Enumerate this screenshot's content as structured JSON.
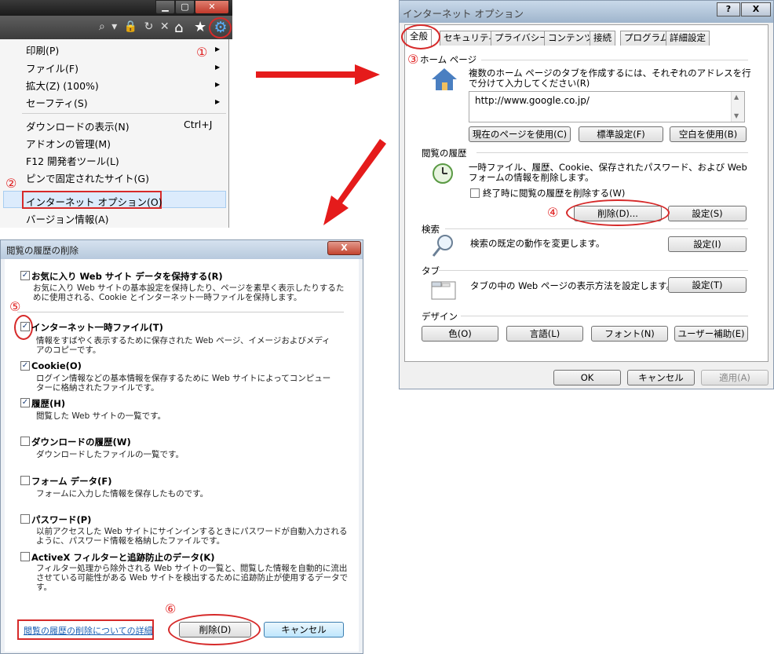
{
  "panel_menu": {
    "window_buttons": {
      "minimize": "▁",
      "maximize": "▢",
      "close": "✕"
    },
    "toolbar_icons": [
      "search-icon",
      "lock-icon",
      "refresh-icon",
      "stop-icon",
      "home-icon",
      "favorites-icon",
      "gear-icon"
    ],
    "toolbar_glyphs": {
      "address": "⌕ ▾ 🔒 ↻ ✕",
      "home": "⌂",
      "star": "★",
      "gear": "⚙"
    },
    "items": [
      {
        "label": "印刷(P)"
      },
      {
        "label": "ファイル(F)"
      },
      {
        "label": "拡大(Z) (100%)"
      },
      {
        "label": "セーフティ(S)"
      },
      {
        "label": "ダウンロードの表示(N)"
      },
      {
        "label": "アドオンの管理(M)"
      },
      {
        "label": "F12 開発者ツール(L)"
      },
      {
        "label": "ピンで固定されたサイト(G)"
      },
      {
        "label": "インターネット オプション(O)"
      },
      {
        "label": "バージョン情報(A)"
      }
    ],
    "shortcut": "Ctrl+J",
    "submenu_arrow": "▶",
    "annotation_1": "①",
    "annotation_2": "②"
  },
  "panel_options": {
    "title": "インターネット オプション",
    "help_button": "?",
    "close_button": "X",
    "tabs": [
      "全般",
      "セキュリティ",
      "プライバシー",
      "コンテンツ",
      "接続",
      "プログラム",
      "詳細設定"
    ],
    "home_page": {
      "group_label": "ホーム ページ",
      "description": "複数のホーム ページのタブを作成するには、それぞれのアドレスを行で分けて入力してください(R)",
      "url": "http://www.google.co.jp/",
      "buttons": [
        "現在のページを使用(C)",
        "標準設定(F)",
        "空白を使用(B)"
      ]
    },
    "history": {
      "group_label": "閲覧の履歴",
      "description": "一時ファイル、履歴、Cookie、保存されたパスワード、および Web フォームの情報を削除します。",
      "checkbox_label": "終了時に閲覧の履歴を削除する(W)",
      "delete_button": "削除(D)...",
      "settings_button": "設定(S)"
    },
    "search": {
      "group_label": "検索",
      "description": "検索の既定の動作を変更します。",
      "settings_button": "設定(I)"
    },
    "tabs_group": {
      "group_label": "タブ",
      "description": "タブの中の Web ページの表示方法を設定します。",
      "settings_button": "設定(T)"
    },
    "design": {
      "group_label": "デザイン",
      "buttons": [
        "色(O)",
        "言語(L)",
        "フォント(N)",
        "ユーザー補助(E)"
      ]
    },
    "footer_buttons": {
      "ok": "OK",
      "cancel": "キャンセル",
      "apply": "適用(A)"
    },
    "annotation_3": "③",
    "annotation_4": "④"
  },
  "panel_delete": {
    "title": "閲覧の履歴の削除",
    "close_button": "X",
    "options": [
      {
        "title": "お気に入り Web サイト データを保持する(R)",
        "checked": true,
        "desc": "お気に入り Web サイトの基本設定を保持したり、ページを素早く表示したりするために使用される、Cookie とインターネット一時ファイルを保持します。"
      },
      {
        "title": "インターネット一時ファイル(T)",
        "checked": true,
        "desc": "情報をすばやく表示するために保存された Web ページ、イメージおよびメディアのコピーです。"
      },
      {
        "title": "Cookie(O)",
        "checked": true,
        "desc": "ログイン情報などの基本情報を保存するために Web サイトによってコンピューターに格納されたファイルです。"
      },
      {
        "title": "履歴(H)",
        "checked": true,
        "desc": "閲覧した Web サイトの一覧です。"
      },
      {
        "title": "ダウンロードの履歴(W)",
        "checked": false,
        "desc": "ダウンロードしたファイルの一覧です。"
      },
      {
        "title": "フォーム データ(F)",
        "checked": false,
        "desc": "フォームに入力した情報を保存したものです。"
      },
      {
        "title": "パスワード(P)",
        "checked": false,
        "desc": "以前アクセスした Web サイトにサインインするときにパスワードが自動入力されるように、パスワード情報を格納したファイルです。"
      },
      {
        "title": "ActiveX フィルターと追跡防止のデータ(K)",
        "checked": false,
        "desc": "フィルター処理から除外される Web サイトの一覧と、閲覧した情報を自動的に流出させている可能性がある Web サイトを検出するために追跡防止が使用するデータです。"
      }
    ],
    "details_link": "閲覧の履歴の削除についての詳細",
    "delete_button": "削除(D)",
    "cancel_button": "キャンセル",
    "annotation_5": "⑤",
    "annotation_6": "⑥"
  },
  "colors": {
    "annotation_red": "#d62a2a",
    "arrow_red": "#e51b1b",
    "link_blue": "#1a5fb4",
    "gear_blue": "#5ab0ff"
  }
}
